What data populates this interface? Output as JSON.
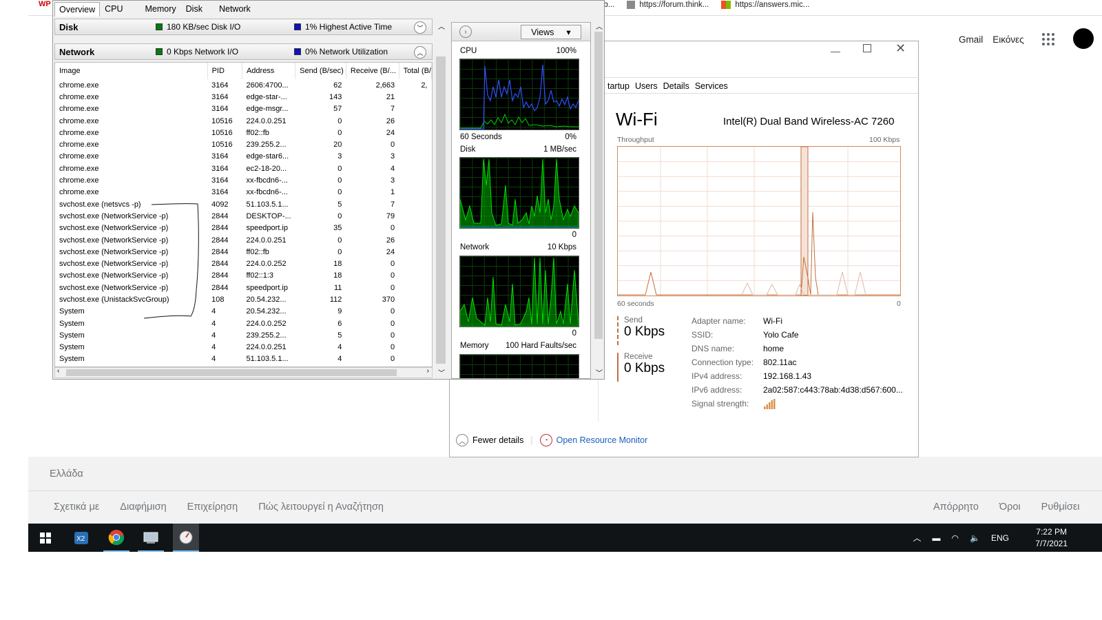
{
  "browser": {
    "bookmarks": [
      "ub...",
      "https://forum.think...",
      "https://answers.mic..."
    ],
    "logo_text": "WP",
    "google_links": [
      "Gmail",
      "Εικόνες"
    ],
    "footer": {
      "country": "Ελλάδα",
      "left_links": [
        "Σχετικά με",
        "Διαφήμιση",
        "Επιχείρηση",
        "Πώς λειτουργεί η Αναζήτηση"
      ],
      "right_links": [
        "Απόρρητο",
        "Όροι",
        "Ρυθμίσει"
      ]
    }
  },
  "taskbar": {
    "apps": [
      "windows-start",
      "xmind",
      "chrome",
      "network-monitor",
      "resource-monitor"
    ],
    "tray": {
      "lang": "ENG",
      "time": "7:22 PM",
      "date": "7/7/2021"
    }
  },
  "task_manager": {
    "tabs": [
      "tartup",
      "Users",
      "Details",
      "Services"
    ],
    "wifi": {
      "title": "Wi-Fi",
      "adapter": "Intel(R) Dual Band Wireless-AC 7260",
      "throughput_label": "Throughput",
      "throughput_max": "100 Kbps",
      "seconds_label": "60 seconds",
      "zero_label": "0",
      "send_label": "Send",
      "send_value": "0 Kbps",
      "receive_label": "Receive",
      "receive_value": "0 Kbps",
      "details": [
        {
          "label": "Adapter name:",
          "value": "Wi-Fi"
        },
        {
          "label": "SSID:",
          "value": "Yolo Cafe"
        },
        {
          "label": "DNS name:",
          "value": "home"
        },
        {
          "label": "Connection type:",
          "value": "802.11ac"
        },
        {
          "label": "IPv4 address:",
          "value": "192.168.1.43"
        },
        {
          "label": "IPv6 address:",
          "value": "2a02:587:c443:78ab:4d38:d567:600..."
        },
        {
          "label": "Signal strength:",
          "value": ""
        }
      ]
    },
    "fewer_details": "Fewer details",
    "open_resource_monitor": "Open Resource Monitor"
  },
  "resource_monitor": {
    "tabs": [
      "Overview",
      "CPU",
      "Memory",
      "Disk",
      "Network"
    ],
    "disk": {
      "title": "Disk",
      "io": "180 KB/sec Disk I/O",
      "active": "1% Highest Active Time"
    },
    "network": {
      "title": "Network",
      "io": "0 Kbps Network I/O",
      "util": "0% Network Utilization"
    },
    "columns": [
      "Image",
      "PID",
      "Address",
      "Send (B/sec)",
      "Receive (B/...",
      "Total (B/"
    ],
    "rows": [
      [
        "chrome.exe",
        "3164",
        "2606:4700...",
        "62",
        "2,663",
        "2,"
      ],
      [
        "chrome.exe",
        "3164",
        "edge-star-...",
        "143",
        "21",
        ""
      ],
      [
        "chrome.exe",
        "3164",
        "edge-msgr...",
        "57",
        "7",
        ""
      ],
      [
        "chrome.exe",
        "10516",
        "224.0.0.251",
        "0",
        "26",
        ""
      ],
      [
        "chrome.exe",
        "10516",
        "ff02::fb",
        "0",
        "24",
        ""
      ],
      [
        "chrome.exe",
        "10516",
        "239.255.2...",
        "20",
        "0",
        ""
      ],
      [
        "chrome.exe",
        "3164",
        "edge-star6...",
        "3",
        "3",
        ""
      ],
      [
        "chrome.exe",
        "3164",
        "ec2-18-20...",
        "0",
        "4",
        ""
      ],
      [
        "chrome.exe",
        "3164",
        "xx-fbcdn6-...",
        "0",
        "3",
        ""
      ],
      [
        "chrome.exe",
        "3164",
        "xx-fbcdn6-...",
        "0",
        "1",
        ""
      ],
      [
        "svchost.exe (netsvcs -p)",
        "4092",
        "51.103.5.1...",
        "5",
        "7",
        ""
      ],
      [
        "svchost.exe (NetworkService -p)",
        "2844",
        "DESKTOP-...",
        "0",
        "79",
        ""
      ],
      [
        "svchost.exe (NetworkService -p)",
        "2844",
        "speedport.ip",
        "35",
        "0",
        ""
      ],
      [
        "svchost.exe (NetworkService -p)",
        "2844",
        "224.0.0.251",
        "0",
        "26",
        ""
      ],
      [
        "svchost.exe (NetworkService -p)",
        "2844",
        "ff02::fb",
        "0",
        "24",
        ""
      ],
      [
        "svchost.exe (NetworkService -p)",
        "2844",
        "224.0.0.252",
        "18",
        "0",
        ""
      ],
      [
        "svchost.exe (NetworkService -p)",
        "2844",
        "ff02::1:3",
        "18",
        "0",
        ""
      ],
      [
        "svchost.exe (NetworkService -p)",
        "2844",
        "speedport.ip",
        "11",
        "0",
        ""
      ],
      [
        "svchost.exe (UnistackSvcGroup)",
        "108",
        "20.54.232...",
        "112",
        "370",
        ""
      ],
      [
        "System",
        "4",
        "20.54.232...",
        "9",
        "0",
        ""
      ],
      [
        "System",
        "4",
        "224.0.0.252",
        "6",
        "0",
        ""
      ],
      [
        "System",
        "4",
        "239.255.2...",
        "5",
        "0",
        ""
      ],
      [
        "System",
        "4",
        "224.0.0.251",
        "4",
        "0",
        ""
      ],
      [
        "System",
        "4",
        "51.103.5.1...",
        "4",
        "0",
        ""
      ]
    ],
    "graphs": {
      "views_label": "Views",
      "cpu": {
        "label": "CPU",
        "max": "100%",
        "seconds": "60 Seconds",
        "min": "0%"
      },
      "disk": {
        "label": "Disk",
        "max": "1 MB/sec",
        "min": "0"
      },
      "network": {
        "label": "Network",
        "max": "10 Kbps",
        "min": "0"
      },
      "memory": {
        "label": "Memory",
        "max": "100 Hard Faults/sec"
      }
    }
  },
  "colors": {
    "graph_green": "#00d000",
    "graph_blue": "#3050ff",
    "throughput": "#c07040",
    "link": "#1a5ebd"
  }
}
